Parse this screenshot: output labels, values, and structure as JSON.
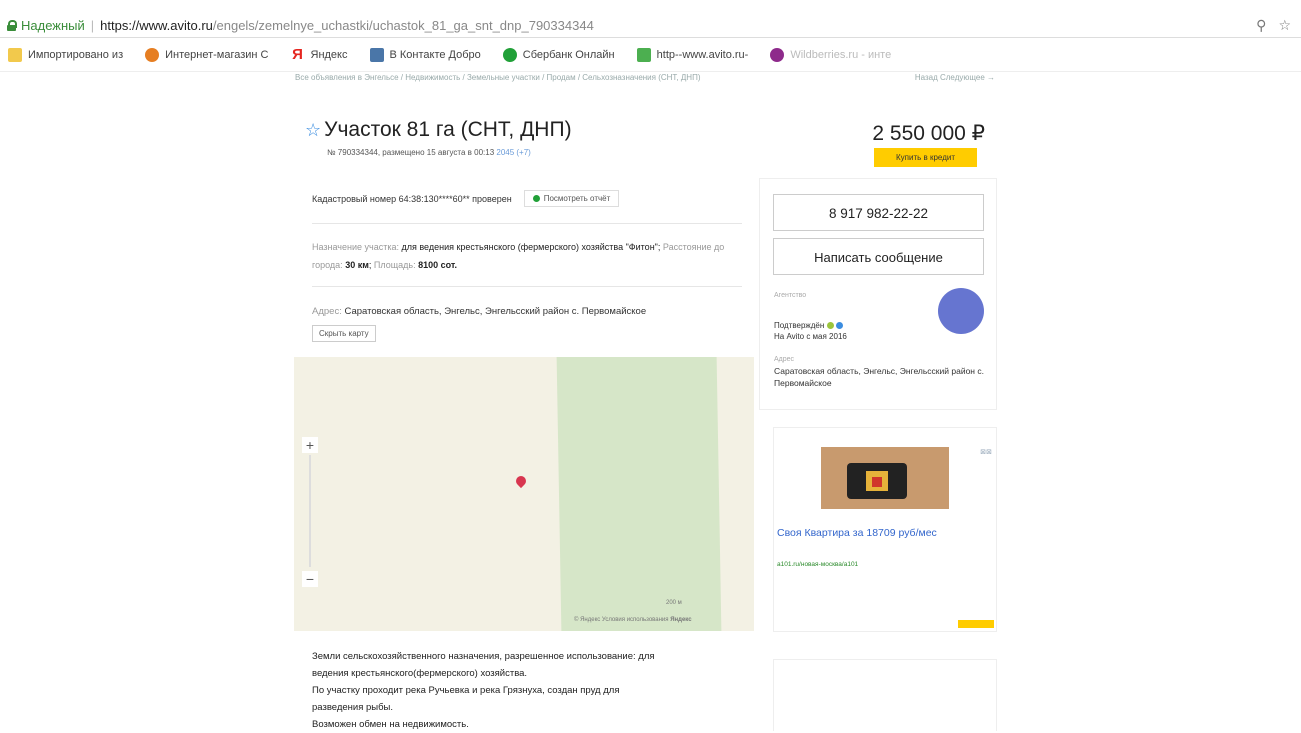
{
  "browser": {
    "secure_label": "Надежный",
    "url_host": "https://www.avito.ru",
    "url_path": "/engels/zemelnye_uchastki/uchastok_81_ga_snt_dnp_790334344",
    "bookmarks": [
      {
        "icon": "folder-icon",
        "label": "Импортировано из"
      },
      {
        "icon": "ie-icon",
        "label": "Интернет-магазин С"
      },
      {
        "icon": "yandex-icon",
        "label": "Яндекс"
      },
      {
        "icon": "vk-icon",
        "label": "В Контакте  Добро"
      },
      {
        "icon": "sberbank-icon",
        "label": "Сбербанк Онлайн"
      },
      {
        "icon": "avito-icon",
        "label": "http--www.avito.ru-"
      },
      {
        "icon": "wildberries-icon",
        "label": "Wildberries.ru - инте"
      }
    ]
  },
  "breadcrumbs": {
    "left": "Все объявления в Энгельсе / Недвижимость / Земельные участки / Продам / Сельхозназначения (СНТ, ДНП)",
    "right": "Назад  Следующее →"
  },
  "listing": {
    "title": "Участок 81 га (СНТ, ДНП)",
    "subtitle": "№ 790334344, размещено 15 августа в 00:13",
    "views": "2045 (+7)",
    "price": "2 550 000 ₽",
    "credit_button": "Купить в кредит",
    "cadastral": "Кадастровый номер 64:38:130****60** проверен",
    "report_button": "Посмотреть отчёт",
    "purpose_label": "Назначение участка:",
    "purpose_value": "для ведения крестьянского (фермерского) хозяйства \"Фитон\"",
    "distance_label": "Расстояние до города:",
    "distance_value": "30 км",
    "area_label": "Площадь:",
    "area_value": "8100 сот.",
    "address_label": "Адрес:",
    "address_value": "Саратовская область, Энгельс, Энгельсский район с. Первомайское",
    "hide_map_button": "Скрыть карту",
    "map_scale": "200 м",
    "map_footer": "© Яндекс  Условия использования",
    "map_brand": "Яндекс",
    "description": [
      "Земли сельскохозяйственного назначения, разрешенное использование: для",
      "ведения крестьянского(фермерского) хозяйства.",
      "По участку проходит река Ручьевка и река Грязнуха, создан пруд для",
      "разведения рыбы.",
      "Возможен обмен на недвижимость."
    ]
  },
  "seller": {
    "phone": "8 917 982-22-22",
    "message_button": "Написать сообщение",
    "agent_label": "Агентство",
    "confirmed": "Подтверждён",
    "since": "На Avito с мая 2016",
    "address_label": "Адрес",
    "address": "Саратовская область, Энгельс, Энгельсский район с. Первомайское"
  },
  "ad": {
    "title": "Своя Квартира за 18709 руб/мес",
    "link": "a101.ru/новая-москва/a101"
  }
}
